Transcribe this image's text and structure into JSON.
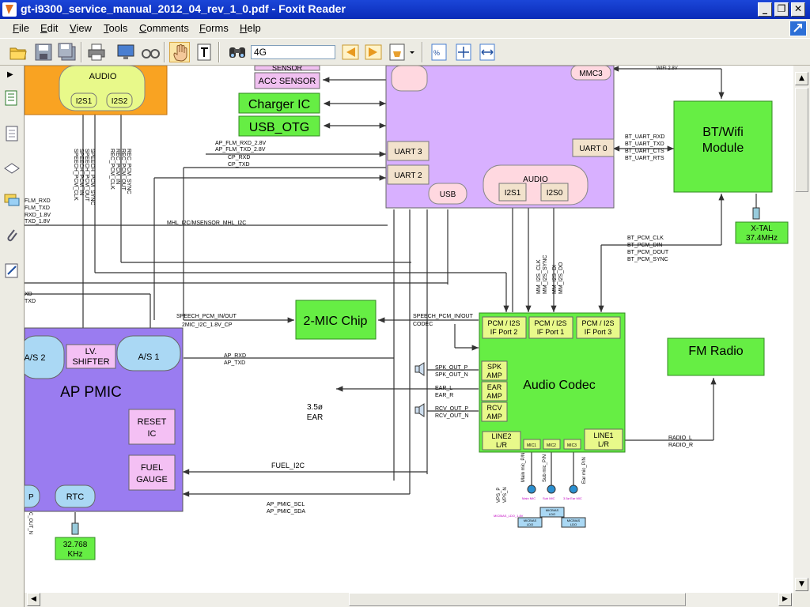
{
  "window": {
    "title": "gt-i9300_service_manual_2012_04_rev_1_0.pdf - Foxit Reader",
    "minimize": "_",
    "maximize": "❐",
    "close": "✕"
  },
  "menu": [
    {
      "label": "File",
      "ul": "F",
      "rest": "ile"
    },
    {
      "label": "Edit",
      "ul": "E",
      "rest": "dit"
    },
    {
      "label": "View",
      "ul": "V",
      "rest": "iew"
    },
    {
      "label": "Tools",
      "ul": "T",
      "rest": "ools"
    },
    {
      "label": "Comments",
      "ul": "C",
      "rest": "omments"
    },
    {
      "label": "Forms",
      "ul": "F",
      "rest": "orms"
    },
    {
      "label": "Help",
      "ul": "H",
      "rest": "elp"
    }
  ],
  "toolbar": {
    "search_value": "4G",
    "icons": [
      "open-icon",
      "save-icon",
      "save-as-icon",
      "print-icon",
      "screen-icon",
      "glasses-icon",
      "hand-tool-icon",
      "text-select-icon",
      "find-icon",
      "search-prev-icon",
      "search-next-icon",
      "highlight-icon",
      "actual-size-icon",
      "fit-page-icon",
      "fit-width-icon"
    ]
  },
  "left_panel_icons": [
    "bookmarks-icon",
    "pages-icon",
    "layers-icon",
    "comments-icon",
    "attachments-icon",
    "signature-icon"
  ],
  "colors": {
    "titlebar": "#0a2bb8",
    "audio_block": "#f9a322",
    "ap_block": "#d2a6ff",
    "green_block": "#66ee44",
    "pmic_block": "#9a7cf0",
    "pink": "#f0c0f0"
  },
  "diagram": {
    "top_left_block": {
      "audio": "AUDIO",
      "i2s1": "I2S1",
      "i2s2": "I2S2"
    },
    "sensor": "SENSOR",
    "acc_sensor": "ACC SENSOR",
    "charger_ic": "Charger IC",
    "usb_otg": "USB_OTG",
    "mmc3": "MMC3",
    "wifi_28v": "WIFI 2.8V",
    "uart3": "UART 3",
    "uart2": "UART 2",
    "usb": "USB",
    "audio": "AUDIO",
    "i2s1": "I2S1",
    "i2s0": "I2S0",
    "uart0": "UART 0",
    "bt_uart": [
      "BT_UART_RXD",
      "BT_UART_TXD",
      "BT_UART_CTS",
      "BT_UART_RTS"
    ],
    "bt_wifi": [
      "BT/Wifi",
      "Module"
    ],
    "xtal": [
      "X-TAL",
      "37.4MHz"
    ],
    "ap_flm": [
      "AP_FLM_RXD_2.8V",
      "AP_FLM_TXD_2.8V",
      "CP_RXD",
      "CP_TXD"
    ],
    "vert_labels_a": [
      "SPEECH_PCM_CLK",
      "SPEECH_PCM_IN",
      "SPEECH_PCM_OUT",
      "SPEECH_PCM_SYNC"
    ],
    "vert_labels_b": [
      "REC_PCM_CLK",
      "REC_PCM_IN",
      "REC_PCM_OUT",
      "REC_PCM_SYNC"
    ],
    "left_labels": [
      "FLM_RXD",
      "FLM_TXD",
      "RXD_1.8V",
      "TXD_1.8V"
    ],
    "mhl": "MHL_I2C/MSENSOR_MHL_I2C",
    "bt_pcm": [
      "BT_PCM_CLK",
      "BT_PCM_DIN",
      "BT_PCM_DOUT",
      "BT_PCM_SYNC"
    ],
    "mm_i2s": [
      "MM_I2S_CLK",
      "MM_I2S_SYNC",
      "MM_I2S_DI",
      "MM_I2S_DO"
    ],
    "left_labels2": [
      "XD",
      "TXD"
    ],
    "speech_pcm_inout": "SPEECH_PCM_IN/OUT",
    "mic_i2c": "2MIC_I2C_1.8V_CP",
    "two_mic": "2-MIC Chip",
    "speech_pcm_inout_r": "SPEECH_PCM_IN/OUT",
    "codec": "CODEC",
    "pcm_ports": [
      [
        "PCM / I2S",
        "IF Port 2"
      ],
      [
        "PCM / I2S",
        "IF Port 1"
      ],
      [
        "PCM / I2S",
        "IF Port 3"
      ]
    ],
    "fm_radio": "FM Radio",
    "as2": "A/S 2",
    "lv_shifter": [
      "LV.",
      "SHIFTER"
    ],
    "as1": "A/S 1",
    "ap_rxd_txd": [
      "AP_RXD",
      "AP_TXD"
    ],
    "ap_pmic": "AP PMIC",
    "reset_ic": [
      "RESET",
      "IC"
    ],
    "fuel_gauge": [
      "FUEL",
      "GAUGE"
    ],
    "p_label": "P",
    "rtc": "RTC",
    "crystal": [
      "32.768",
      "KHz"
    ],
    "ear_35": [
      "3.5ø",
      "EAR"
    ],
    "spk_out": [
      "SPK_OUT_P",
      "SPK_OUT_N"
    ],
    "ear_lr": [
      "EAR_L",
      "EAR_R"
    ],
    "rcv_out": [
      "RCV_OUT_P",
      "RCV_OUT_N"
    ],
    "spk_amp": [
      "SPK",
      "AMP"
    ],
    "ear_amp": [
      "EAR",
      "AMP"
    ],
    "rcv_amp": [
      "RCV",
      "AMP"
    ],
    "audio_codec": "Audio Codec",
    "line2": [
      "LINE2",
      "L/R"
    ],
    "mic_pins": [
      "MIC1",
      "MIC2",
      "MIC3"
    ],
    "line1": [
      "LINE1",
      "L/R"
    ],
    "radio_lr": [
      "RADIO_L",
      "RADIO_R"
    ],
    "fuel_i2c": "FUEL_I2C",
    "ap_pmic_bus": [
      "AP_PMIC_SCL",
      "AP_PMIC_SDA"
    ],
    "vps": [
      "VPS_P",
      "VPS_N"
    ],
    "mic_vert": [
      "Main mic_P/N",
      "Sub mic_P/N",
      "Ear mic_P/N"
    ],
    "mic_names": [
      "Main MIC",
      "Sub MIC",
      "3.5ø Ear MIC"
    ],
    "micbias_label": "MICBIAS_LDO_1.8V",
    "micbias_ldo": [
      "MICBIAS",
      "LDO"
    ],
    "vert_small": [
      "C_OUT_N"
    ]
  }
}
